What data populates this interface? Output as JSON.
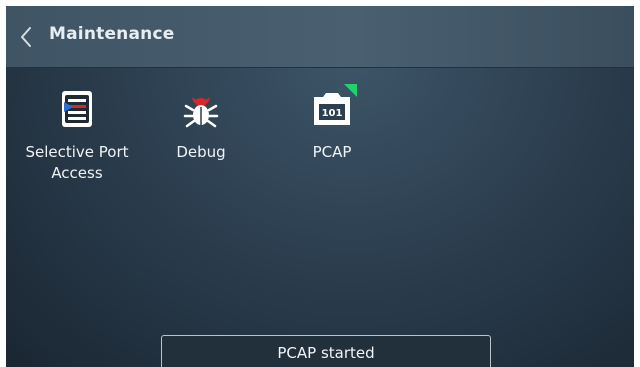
{
  "header": {
    "title": "Maintenance",
    "back_icon": "chevron-left-icon"
  },
  "apps": [
    {
      "label": "Selective Port Access",
      "icon": "port-access-icon"
    },
    {
      "label": "Debug",
      "icon": "bug-icon"
    },
    {
      "label": "PCAP",
      "icon": "pcap-icon",
      "icon_text": "101",
      "badge": "green-corner-flag"
    }
  ],
  "toast": {
    "text": "PCAP started"
  },
  "colors": {
    "background": "#2c3f50",
    "header": "#4a6070",
    "bug_red": "#d8262b",
    "badge_green": "#1ed36a"
  }
}
